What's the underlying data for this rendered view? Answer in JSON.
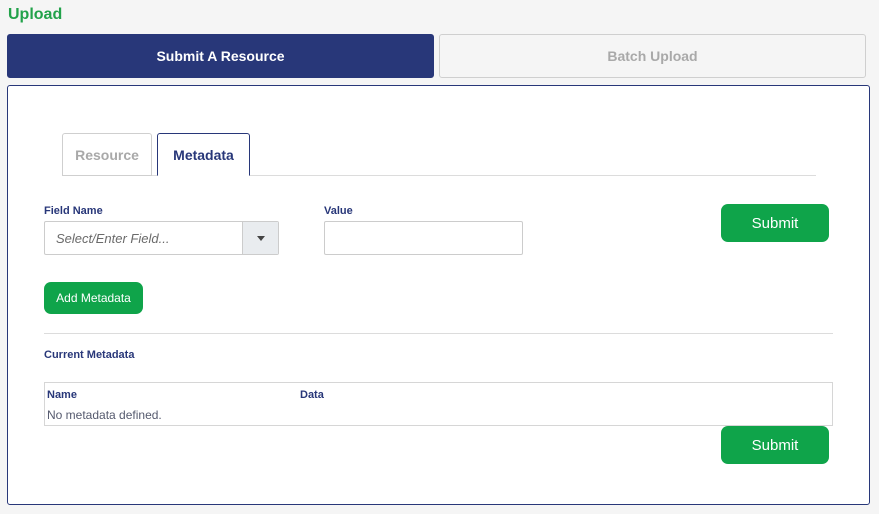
{
  "page": {
    "title": "Upload"
  },
  "main_tabs": [
    {
      "label": "Submit A Resource",
      "active": true
    },
    {
      "label": "Batch Upload",
      "active": false
    }
  ],
  "sub_tabs": [
    {
      "label": "Resource",
      "active": false
    },
    {
      "label": "Metadata",
      "active": true
    }
  ],
  "form": {
    "field_name_label": "Field Name",
    "field_name_placeholder": "Select/Enter Field...",
    "field_name_value": "",
    "value_label": "Value",
    "value_value": "",
    "submit_label": "Submit",
    "add_metadata_label": "Add Metadata"
  },
  "current_metadata": {
    "heading": "Current Metadata",
    "columns": [
      "Name",
      "Data"
    ],
    "empty_message": "No metadata defined."
  },
  "colors": {
    "accent_navy": "#283779",
    "brand_green": "#22a24a",
    "button_green": "#0fa44a"
  },
  "icons": {
    "dropdown": "chevron-down-icon"
  }
}
